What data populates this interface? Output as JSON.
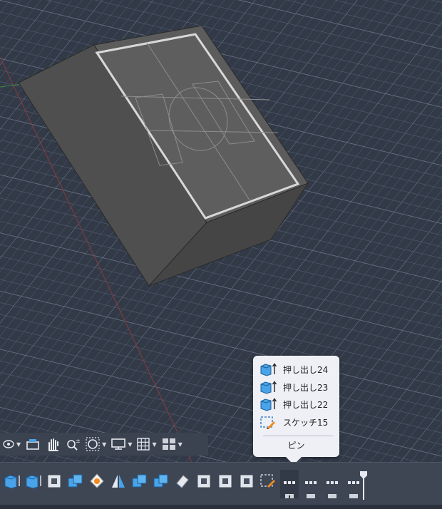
{
  "popup": {
    "items": [
      {
        "label": "押し出し24",
        "icon": "extrude-icon"
      },
      {
        "label": "押し出し23",
        "icon": "extrude-icon"
      },
      {
        "label": "押し出し22",
        "icon": "extrude-icon"
      },
      {
        "label": "スケッチ15",
        "icon": "sketch-icon"
      }
    ],
    "pin_label": "ピン"
  },
  "navbar": {
    "tools": [
      "orbit-icon",
      "look-at-icon",
      "pan-icon",
      "zoom-icon",
      "fit-icon",
      "display-settings-icon",
      "grid-icon",
      "viewports-icon"
    ]
  },
  "timeline": {
    "features": [
      "extrude-icon",
      "extrude-icon",
      "shell-icon",
      "combine-icon",
      "paint-icon",
      "mirror-icon",
      "combine-icon",
      "combine-icon",
      "erase-icon",
      "shell-icon",
      "shell-icon",
      "shell-icon",
      "sketch-icon"
    ],
    "groups": 4
  },
  "colors": {
    "background": "#323a48",
    "grid": "#5a6373",
    "body_face": "#595959",
    "popup_bg": "#eef0f5",
    "timeline_bg": "#3e4654",
    "accent_blue": "#4aa3e8"
  }
}
